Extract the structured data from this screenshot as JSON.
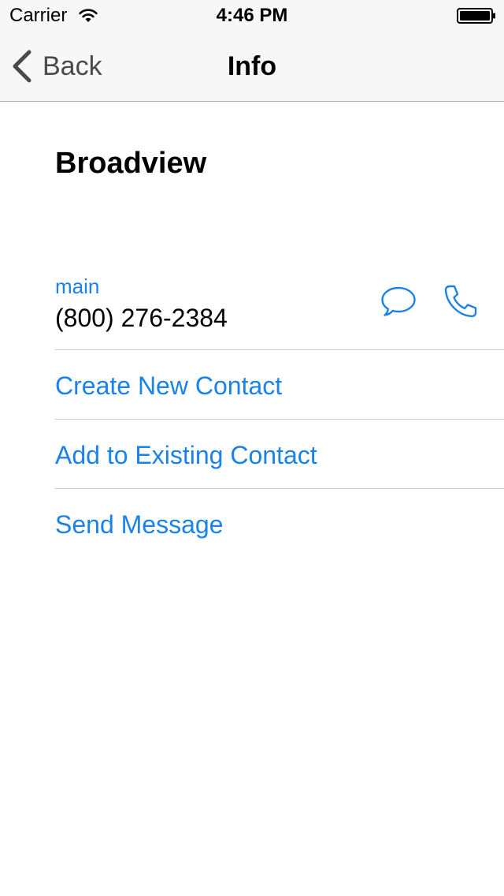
{
  "status_bar": {
    "carrier": "Carrier",
    "time": "4:46 PM",
    "wifi_icon": "wifi-icon",
    "battery_icon": "battery-icon"
  },
  "nav": {
    "back_label": "Back",
    "title": "Info",
    "back_icon": "chevron-left-icon"
  },
  "contact": {
    "name": "Broadview",
    "phone": {
      "label": "main",
      "number": "(800) 276-2384",
      "message_icon": "message-bubble-icon",
      "call_icon": "phone-icon"
    }
  },
  "actions": [
    {
      "label": "Create New Contact"
    },
    {
      "label": "Add to Existing Contact"
    },
    {
      "label": "Send Message"
    }
  ],
  "colors": {
    "accent": "#1a82e8",
    "nav_background": "#f7f7f7",
    "separator": "#c8c7cc",
    "back_text": "#4a4a4a"
  }
}
